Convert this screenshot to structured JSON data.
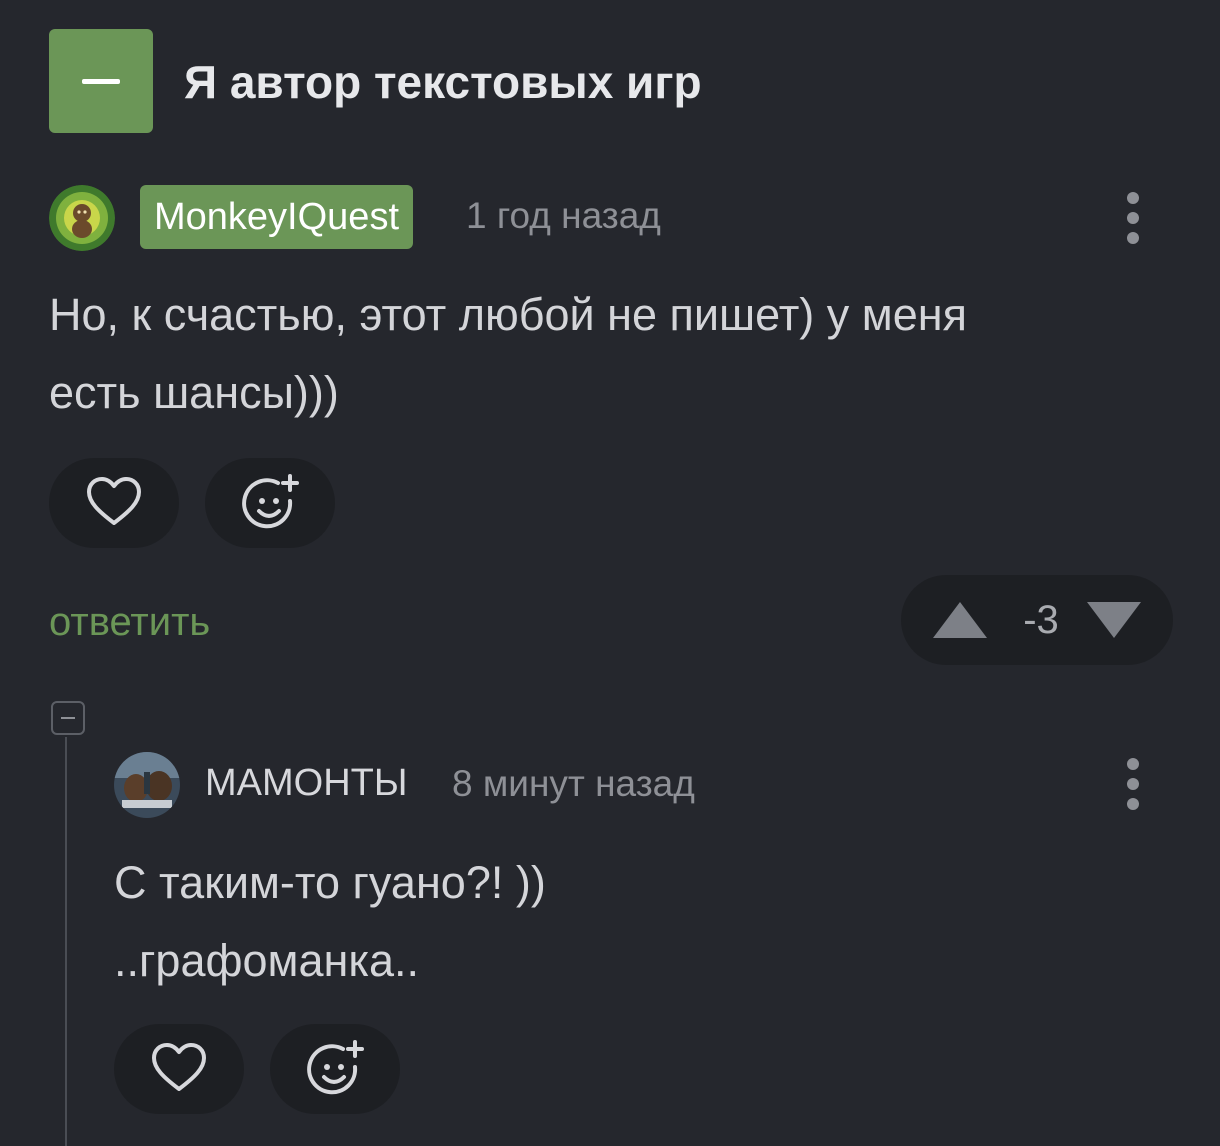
{
  "post": {
    "title": "Я автор текстовых игр"
  },
  "comments": [
    {
      "author": "MonkeyIQuest",
      "time": "1 год назад",
      "text_lines": [
        "Но, к счастью, этот любой не пишет) у меня",
        "есть шансы)))"
      ],
      "reply_label": "ответить",
      "rating": "-3"
    },
    {
      "author": "МАМОНТЫ",
      "time": "8 минут назад",
      "text_lines": [
        "С таким-то гуано?! ))",
        "..графоманка.."
      ]
    }
  ],
  "icons": {
    "collapse": "minus-icon",
    "like": "heart-icon",
    "react": "emoji-add-icon",
    "menu": "kebab-menu-icon",
    "upvote": "triangle-up-icon",
    "downvote": "triangle-down-icon"
  },
  "colors": {
    "background": "#25272d",
    "accent": "#6b9657",
    "button_bg": "#1d1f23",
    "muted_text": "#8e9096"
  }
}
